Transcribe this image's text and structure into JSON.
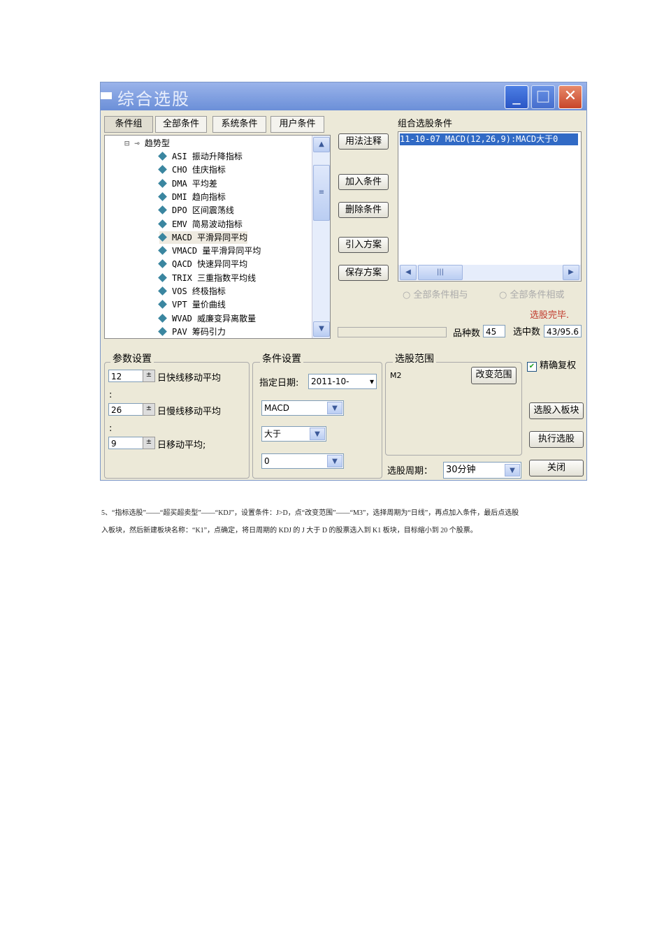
{
  "window": {
    "title": "综合选股",
    "minimize": "_",
    "maximize": "□",
    "close": "✕"
  },
  "tabs": [
    "条件组",
    "全部条件",
    "系统条件",
    "用户条件"
  ],
  "tree": {
    "group": "趋势型",
    "items": [
      "ASI 振动升降指标",
      "CHO 佳庆指标",
      "DMA 平均差",
      "DMI 趋向指标",
      "DPO 区间震荡线",
      "EMV 简易波动指标",
      "MACD 平滑异同平均",
      "VMACD 量平滑异同平均",
      "QACD 快速异同平均",
      "TRIX 三重指数平均线",
      "VOS 终极指标",
      "VPT 量价曲线",
      "WVAD 威廉变异离散量",
      "PAV 筹码引力"
    ],
    "selected_index": 6
  },
  "buttons": {
    "usage": "用法注释",
    "add": "加入条件",
    "delete": "删除条件",
    "import": "引入方案",
    "save": "保存方案",
    "change_range": "改变范围",
    "to_block": "选股入板块",
    "execute": "执行选股",
    "close": "关闭"
  },
  "conditions": {
    "label": "组合选股条件",
    "items": [
      "11-10-07 MACD(12,26,9):MACD大于0"
    ]
  },
  "radios": {
    "and": "全部条件相与",
    "or": "全部条件相或"
  },
  "status": {
    "done": "选股完毕.",
    "count_label": "品种数",
    "count": "45",
    "selected_label": "选中数",
    "selected": "43/95.6"
  },
  "params": {
    "label": "参数设置",
    "rows": [
      {
        "value": "12",
        "text": "日快线移动平均"
      },
      {
        "value": "26",
        "text": "日慢线移动平均"
      },
      {
        "value": "9",
        "text": "日移动平均;"
      }
    ],
    "sep": ":"
  },
  "cond_set": {
    "label": "条件设置",
    "date_label": "指定日期:",
    "date": "2011-10-",
    "indicator": "MACD",
    "op": "大于",
    "value": "0"
  },
  "range": {
    "label": "选股范围",
    "value": "M2"
  },
  "exact": {
    "label": "精确复权",
    "checked": true
  },
  "period": {
    "label": "选股周期：",
    "value": "30分钟"
  },
  "doc": {
    "line1": "5、“指标选股”——“超买超卖型”——“KDJ”，设置条件：J>D，点“改变范围”——“M3”，选择周期为“日线”，再点加入条件，最后点选股",
    "line2": "入板块，然后新建板块名称：“K1”，点确定，将日周期的 KDJ 的 J 大于 D 的股票选入到 K1 板块，目标缩小到 20 个股票。"
  }
}
